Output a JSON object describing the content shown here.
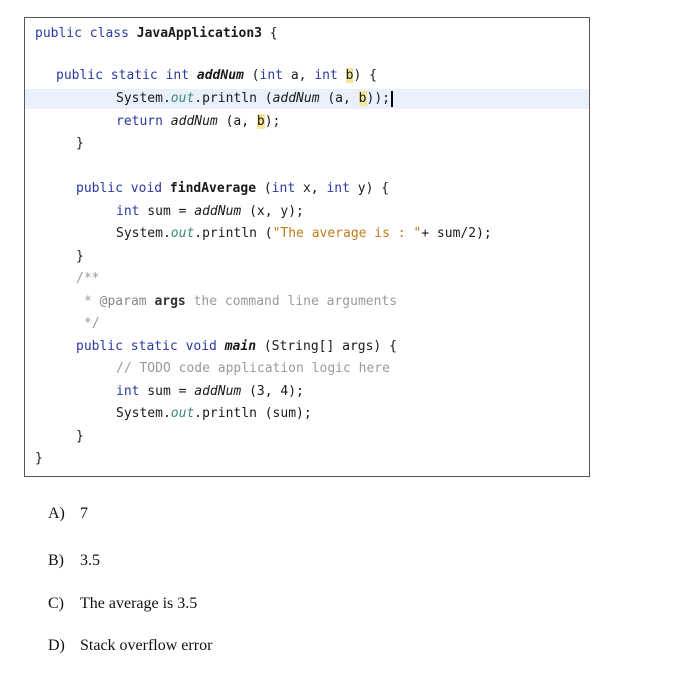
{
  "code": {
    "line1": {
      "kw": "public class ",
      "name": "JavaApplication3",
      "rest": " {"
    },
    "line2": {
      "kw1": "public static int ",
      "method": "addNum",
      "p1": " (",
      "kw2": "int",
      "p2": " a, ",
      "kw3": "int",
      "p3": " ",
      "b": "b",
      "p4": ") {"
    },
    "line3": {
      "a": "System.",
      "field": "out",
      "b": ".println (",
      "call": "addNum",
      "c": " (a, ",
      "b_var": "b",
      "d": "));"
    },
    "line4": {
      "kw": "return ",
      "call": "addNum",
      "a": " (a, ",
      "b_var": "b",
      "b": ");"
    },
    "line5": {
      "text": "}"
    },
    "line6": {
      "kw1": "public void ",
      "method": "findAverage",
      "p1": " (",
      "kw2": "int",
      "p2": " x, ",
      "kw3": "int",
      "p3": " y) {"
    },
    "line7": {
      "kw": "int",
      "a": " sum = ",
      "call": "addNum",
      "b": " (x, y);"
    },
    "line8": {
      "a": "System.",
      "field": "out",
      "b": ".println (",
      "str": "\"The average is : \"",
      "c": "+ sum/2);"
    },
    "line9": {
      "text": "}"
    },
    "line10": {
      "text": "/**"
    },
    "line11": {
      "star": "* ",
      "ann": "@param",
      "bold": " args",
      "rest": " the command line arguments"
    },
    "line12": {
      "text": "*/"
    },
    "line13": {
      "kw1": "public static void ",
      "method": "main",
      "a": " (String[] args) {"
    },
    "line14": {
      "text": "// TODO code application logic here"
    },
    "line15": {
      "kw": "int",
      "a": " sum = ",
      "call": "addNum",
      "b": " (3, 4);"
    },
    "line16": {
      "a": "System.",
      "field": "out",
      "b": ".println (sum);"
    },
    "line17": {
      "text": "}"
    },
    "line18": {
      "text": "}"
    }
  },
  "answers": [
    {
      "letter": "A)",
      "text": "7"
    },
    {
      "letter": "B)",
      "text": "3.5"
    },
    {
      "letter": "C)",
      "text": "The average is 3.5"
    },
    {
      "letter": "D)",
      "text": "Stack overflow error"
    }
  ],
  "colors": {
    "keyword": "#2a3aa0",
    "field": "#3a8a7a",
    "string": "#c67a1a",
    "comment": "#9a9a9a",
    "highlight_line": "#e8f0fb",
    "occurrence_highlight": "#f3e89a"
  }
}
